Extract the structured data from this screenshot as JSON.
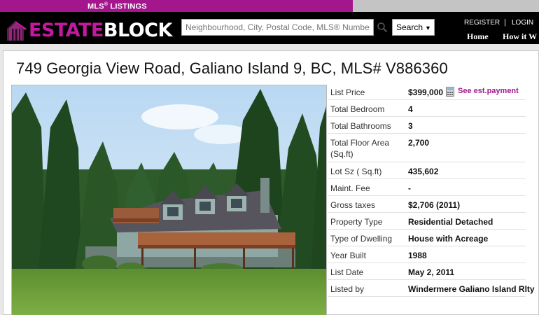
{
  "topbar": {
    "mls_label": "MLS",
    "mls_reg": "®",
    "mls_suffix": " LISTINGS"
  },
  "brand": {
    "part1": "ESTATE",
    "part2": "BLOCK",
    "accent_color": "#c11a9e",
    "header_bg": "#000000"
  },
  "search": {
    "placeholder": "Neighbourhood, City, Postal Code, MLS® Number",
    "button_label": "Search",
    "button_caret": "▼",
    "icon": "magnifier-icon"
  },
  "account": {
    "register": "REGISTER",
    "separator": "|",
    "login": "LOGIN"
  },
  "nav": {
    "home": "Home",
    "how": "How it W"
  },
  "listing": {
    "title": "749 Georgia View Road, Galiano Island 9, BC, MLS# V886360",
    "photo_alt": "House photo",
    "price_label": "List Price",
    "price_value": "$399,000",
    "calc_icon": "calculator-icon",
    "payment_link": "See est.payment",
    "details": [
      {
        "label": "Total Bedroom",
        "value": "4"
      },
      {
        "label": "Total Bathrooms",
        "value": "3"
      },
      {
        "label": "Total Floor Area (Sq.ft)",
        "value": "2,700"
      },
      {
        "label": "Lot Sz ( Sq.ft)",
        "value": "435,602"
      },
      {
        "label": "Maint. Fee",
        "value": "-"
      },
      {
        "label": "Gross taxes",
        "value": "$2,706 (2011)"
      },
      {
        "label": "Property Type",
        "value": "Residential Detached"
      },
      {
        "label": "Type of Dwelling",
        "value": "House with Acreage"
      },
      {
        "label": "Year Built",
        "value": "1988"
      },
      {
        "label": "List Date",
        "value": "May 2, 2011"
      },
      {
        "label": "Listed by",
        "value": "Windermere Galiano Island Rlty"
      }
    ]
  }
}
